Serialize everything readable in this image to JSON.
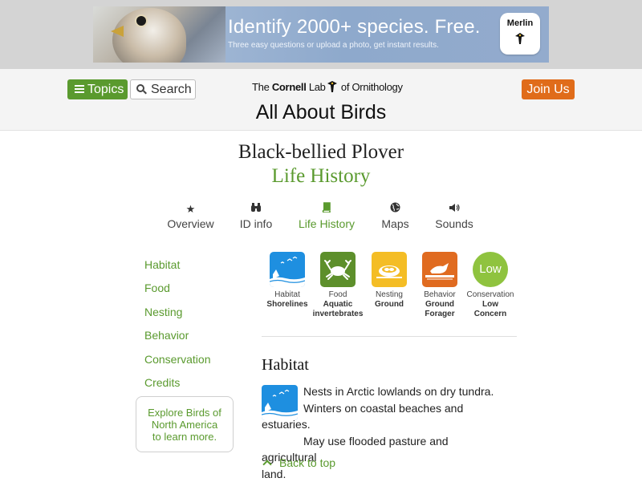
{
  "ad": {
    "headline": "Identify 2000+ species. Free.",
    "subline": "Three easy questions or upload a photo, get instant results.",
    "badge_label": "Merlin"
  },
  "header": {
    "topics_label": "Topics",
    "search_label": "Search",
    "logo_pre": "The ",
    "logo_bold": "Cornell",
    "logo_mid": " Lab",
    "logo_post": " of Ornithology",
    "site_title": "All About Birds",
    "join_label": "Join Us"
  },
  "page": {
    "species": "Black-bellied Plover",
    "section": "Life History"
  },
  "tabs": [
    {
      "label": "Overview",
      "icon": "star-icon"
    },
    {
      "label": "ID info",
      "icon": "binoculars-icon"
    },
    {
      "label": "Life History",
      "icon": "book-icon"
    },
    {
      "label": "Maps",
      "icon": "globe-icon"
    },
    {
      "label": "Sounds",
      "icon": "speaker-icon"
    }
  ],
  "sidebar": {
    "links": [
      "Habitat",
      "Food",
      "Nesting",
      "Behavior",
      "Conservation",
      "Credits"
    ],
    "explore": [
      "Explore Birds of",
      "North America",
      "to learn more."
    ]
  },
  "facts": [
    {
      "category": "Habitat",
      "value": "Shorelines",
      "icon": "shoreline-icon"
    },
    {
      "category": "Food",
      "value_lines": [
        "Aquatic",
        "invertebrates"
      ],
      "icon": "crab-icon"
    },
    {
      "category": "Nesting",
      "value": "Ground",
      "icon": "ground-nest-icon"
    },
    {
      "category": "Behavior",
      "value_lines": [
        "Ground",
        "Forager"
      ],
      "icon": "ground-forager-icon"
    },
    {
      "category": "Conservation",
      "value_lines": [
        "Low",
        "Concern"
      ],
      "badge": "Low"
    }
  ],
  "habitat": {
    "heading": "Habitat",
    "lines": [
      "Nests in Arctic lowlands on dry tundra.",
      "Winters on coastal beaches and estuaries.",
      "May use flooded pasture and agricultural",
      "land."
    ],
    "back_to_top": "Back to top"
  },
  "colors": {
    "brand_green": "#5a9a2e",
    "join_orange": "#e06c1a",
    "habitat_blue": "#1e8fe0",
    "low_concern_green": "#8fc33f"
  }
}
